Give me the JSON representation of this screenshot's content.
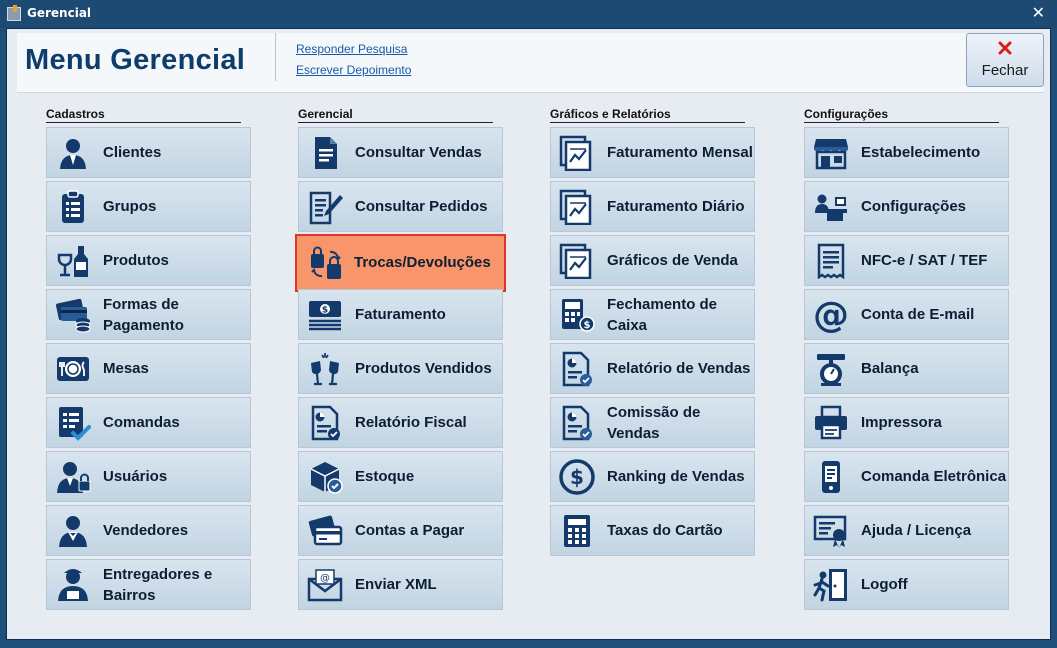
{
  "window": {
    "title": "Gerencial"
  },
  "header": {
    "title": "Menu Gerencial",
    "links": [
      "Responder Pesquisa",
      "Escrever Depoimento"
    ],
    "close_label": "Fechar"
  },
  "columns": [
    {
      "heading": "Cadastros",
      "items": [
        {
          "label": "Clientes",
          "icon": "person-icon"
        },
        {
          "label": "Grupos",
          "icon": "clipboard-list-icon"
        },
        {
          "label": "Produtos",
          "icon": "wine-glass-bottle-icon"
        },
        {
          "label": "Formas de Pagamento",
          "icon": "cards-cash-icon"
        },
        {
          "label": "Mesas",
          "icon": "plate-cutlery-icon"
        },
        {
          "label": "Comandas",
          "icon": "checklist-icon"
        },
        {
          "label": "Usuários",
          "icon": "user-lock-icon"
        },
        {
          "label": "Vendedores",
          "icon": "salesperson-icon"
        },
        {
          "label": "Entregadores e Bairros",
          "icon": "delivery-person-icon"
        }
      ]
    },
    {
      "heading": "Gerencial",
      "items": [
        {
          "label": "Consultar Vendas",
          "icon": "document-icon"
        },
        {
          "label": "Consultar Pedidos",
          "icon": "document-pen-icon"
        },
        {
          "label": "Trocas/Devoluções",
          "icon": "shopping-bags-exchange-icon",
          "highlight": true
        },
        {
          "label": "Faturamento",
          "icon": "cash-stack-icon"
        },
        {
          "label": "Produtos Vendidos",
          "icon": "toast-glasses-icon"
        },
        {
          "label": "Relatório Fiscal",
          "icon": "report-icon"
        },
        {
          "label": "Estoque",
          "icon": "box-check-icon"
        },
        {
          "label": "Contas a Pagar",
          "icon": "credit-cards-icon"
        },
        {
          "label": "Enviar XML",
          "icon": "envelope-at-icon"
        }
      ]
    },
    {
      "heading": "Gráficos e Relatórios",
      "items": [
        {
          "label": "Faturamento Mensal",
          "icon": "chart-doc-icon"
        },
        {
          "label": "Faturamento Diário",
          "icon": "chart-doc-icon"
        },
        {
          "label": "Gráficos de Venda",
          "icon": "chart-doc-icon"
        },
        {
          "label": "Fechamento de Caixa",
          "icon": "calculator-coins-icon"
        },
        {
          "label": "Relatório de Vendas",
          "icon": "report-check-icon"
        },
        {
          "label": "Comissão de Vendas",
          "icon": "report-check-icon"
        },
        {
          "label": "Ranking de Vendas",
          "icon": "dollar-circle-icon"
        },
        {
          "label": "Taxas do Cartão",
          "icon": "calculator-icon"
        }
      ]
    },
    {
      "heading": "Configurações",
      "items": [
        {
          "label": "Estabelecimento",
          "icon": "storefront-icon"
        },
        {
          "label": "Configurações",
          "icon": "people-desk-icon"
        },
        {
          "label": "NFC-e / SAT / TEF",
          "icon": "receipt-icon"
        },
        {
          "label": "Conta de E-mail",
          "icon": "at-sign-icon"
        },
        {
          "label": "Balança",
          "icon": "scale-icon"
        },
        {
          "label": "Impressora",
          "icon": "printer-icon"
        },
        {
          "label": "Comanda Eletrônica",
          "icon": "phone-icon"
        },
        {
          "label": "Ajuda / Licença",
          "icon": "certificate-icon"
        },
        {
          "label": "Logoff",
          "icon": "exit-door-icon"
        }
      ]
    }
  ],
  "colors": {
    "titlebar": "#1d4a73",
    "title_text": "#0f3d6b",
    "button_top": "#d8e5ef",
    "button_bottom": "#c2d4e2",
    "highlight_fill": "#f8956b",
    "highlight_border": "#e0332b",
    "icon": "#143a6b",
    "link": "#1659a8"
  }
}
